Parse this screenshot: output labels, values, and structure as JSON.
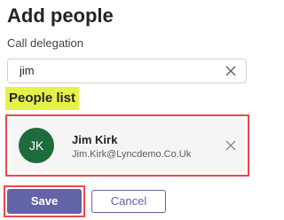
{
  "header": {
    "title": "Add people",
    "subtitle": "Call delegation"
  },
  "search": {
    "value": "jim",
    "clear_icon": "close-icon"
  },
  "people_list": {
    "label": "People list",
    "items": [
      {
        "initials": "JK",
        "name": "Jim Kirk",
        "email": "Jim.Kirk@Lyncdemo.Co.Uk",
        "avatar_color": "#1e6b3c",
        "remove_icon": "close-icon"
      }
    ]
  },
  "actions": {
    "save_label": "Save",
    "cancel_label": "Cancel",
    "accent_color": "#6264a7"
  }
}
